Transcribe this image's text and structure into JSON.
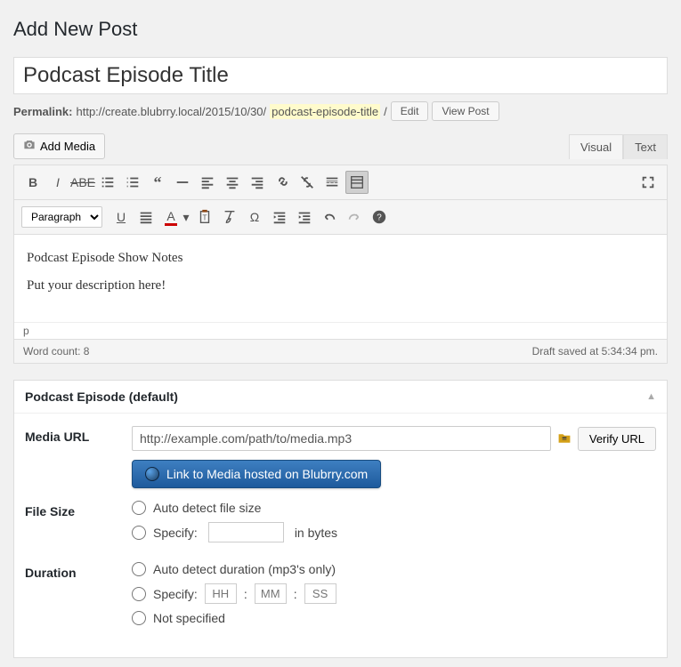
{
  "page_heading": "Add New Post",
  "post_title": "Podcast Episode Title",
  "permalink": {
    "label": "Permalink:",
    "base": "http://create.blubrry.local/2015/10/30/",
    "slug": "podcast-episode-title",
    "trailing": "/",
    "edit_btn": "Edit",
    "view_btn": "View Post"
  },
  "add_media_label": "Add Media",
  "tabs": {
    "visual": "Visual",
    "text": "Text"
  },
  "format_select": "Paragraph",
  "editor": {
    "line1": "Podcast Episode Show Notes",
    "line2": "Put your description here!",
    "path": "p",
    "word_count_label": "Word count: 8",
    "draft_status": "Draft saved at 5:34:34 pm."
  },
  "metabox": {
    "title": "Podcast Episode (default)",
    "media_url_label": "Media URL",
    "media_url_value": "http://example.com/path/to/media.mp3",
    "verify_btn": "Verify URL",
    "blubrry_btn": "Link to Media hosted on Blubrry.com",
    "filesize_label": "File Size",
    "filesize_auto": "Auto detect file size",
    "filesize_specify": "Specify:",
    "filesize_unit": "in bytes",
    "duration_label": "Duration",
    "duration_auto": "Auto detect duration (mp3's only)",
    "duration_specify": "Specify:",
    "duration_hh": "HH",
    "duration_mm": "MM",
    "duration_ss": "SS",
    "duration_notspec": "Not specified"
  }
}
